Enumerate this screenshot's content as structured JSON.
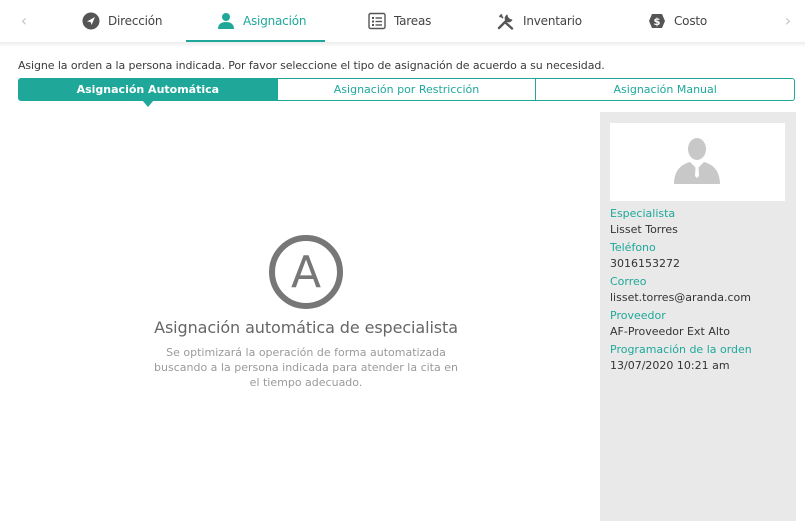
{
  "tabs": [
    {
      "label": "Dirección",
      "icon": "navigation-arrow-icon",
      "active": false
    },
    {
      "label": "Asignación",
      "icon": "user-icon",
      "active": true
    },
    {
      "label": "Tareas",
      "icon": "checklist-icon",
      "active": false
    },
    {
      "label": "Inventario",
      "icon": "tools-icon",
      "active": false
    },
    {
      "label": "Costo",
      "icon": "dollar-icon",
      "active": false
    }
  ],
  "instruction": "Asigne la orden a la persona indicada. Por favor seleccione el tipo de asignación de acuerdo a su necesidad.",
  "assignment_types": [
    {
      "label": "Asignación Automática",
      "active": true
    },
    {
      "label": "Asignación por Restricción",
      "active": false
    },
    {
      "label": "Asignación Manual",
      "active": false
    }
  ],
  "auto": {
    "logo_letter": "A",
    "title": "Asignación automática de especialista",
    "description": "Se optimizará la operación de forma automatizada buscando a la persona indicada para atender la cita en el tiempo adecuado."
  },
  "specialist_panel": {
    "fields": [
      {
        "label": "Especialista",
        "value": "Lisset Torres"
      },
      {
        "label": "Teléfono",
        "value": "3016153272"
      },
      {
        "label": "Correo",
        "value": "lisset.torres@aranda.com"
      },
      {
        "label": "Proveedor",
        "value": "AF-Proveedor Ext Alto"
      },
      {
        "label": "Programación de la orden",
        "value": "13/07/2020 10:21 am"
      }
    ]
  },
  "colors": {
    "accent": "#1fa89a",
    "panel": "#e9e9e9",
    "icon_gray": "#666666"
  }
}
